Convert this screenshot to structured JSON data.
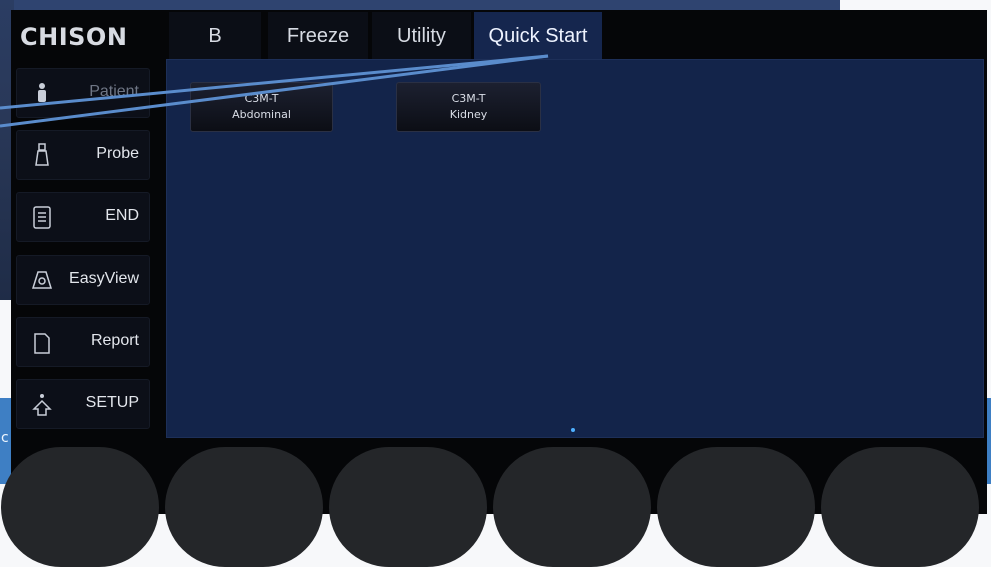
{
  "brand": "CHISON",
  "tabs": [
    {
      "label": "B",
      "active": false
    },
    {
      "label": "Freeze",
      "active": false
    },
    {
      "label": "Utility",
      "active": false
    },
    {
      "label": "Quick Start",
      "active": true
    }
  ],
  "sidebar": {
    "items": [
      {
        "label": "Patient",
        "icon": "patient-icon"
      },
      {
        "label": "Probe",
        "icon": "probe-icon"
      },
      {
        "label": "END",
        "icon": "end-exam-icon"
      },
      {
        "label": "EasyView",
        "icon": "easyview-icon"
      },
      {
        "label": "Report",
        "icon": "report-icon"
      },
      {
        "label": "SETUP",
        "icon": "setup-icon"
      }
    ]
  },
  "quick_start": {
    "presets": [
      {
        "line1": "C3M-T",
        "line2": "Abdominal"
      },
      {
        "line1": "C3M-T",
        "line2": "Kidney"
      }
    ]
  },
  "colors": {
    "content_bg": "#13244a",
    "active_tab": "#15264e",
    "callout_line": "#4f7fc0",
    "desktop_blue": "#3e7fc4"
  }
}
